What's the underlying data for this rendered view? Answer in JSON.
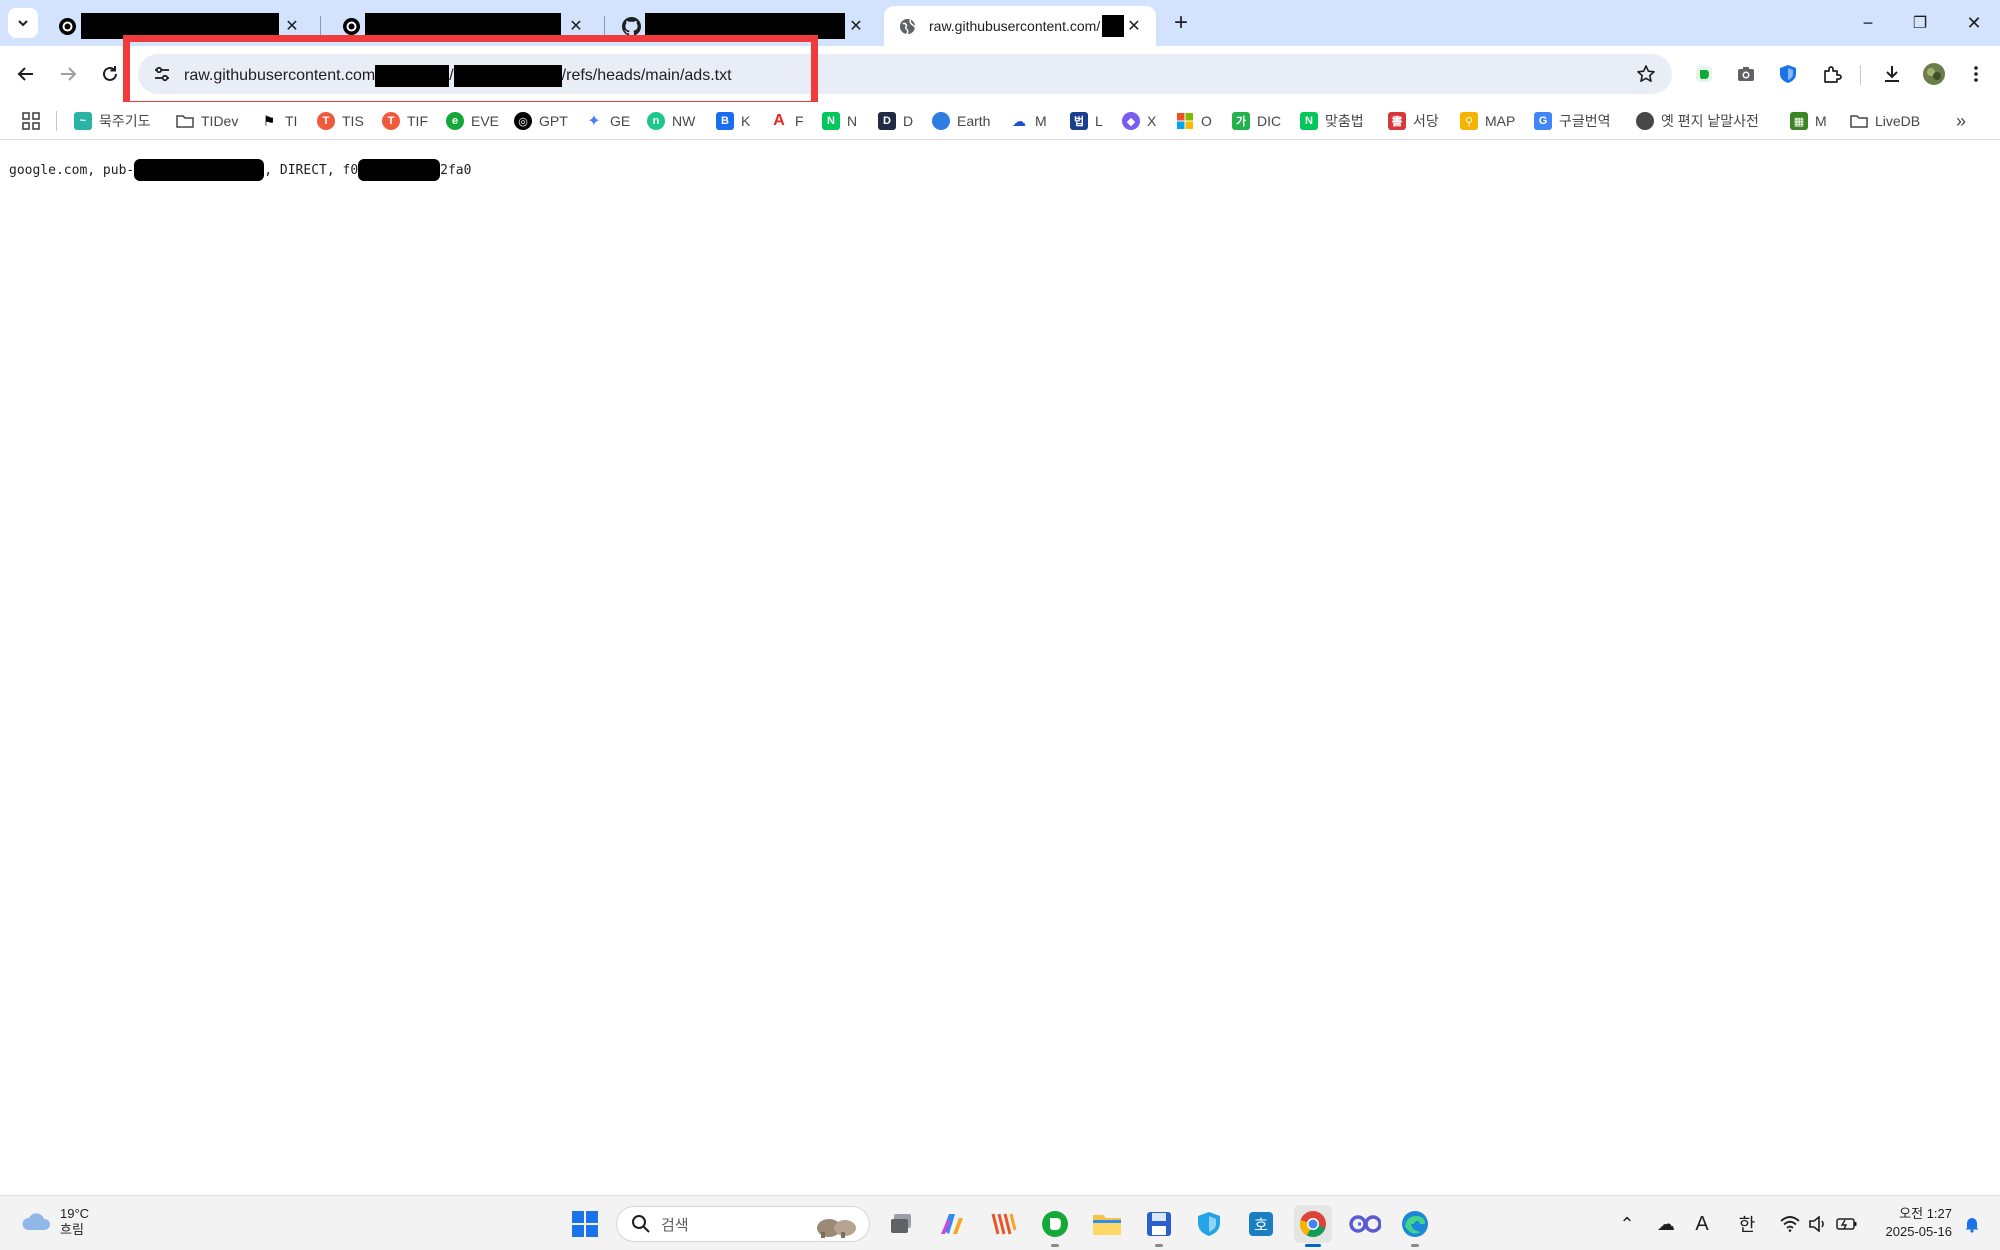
{
  "browser": {
    "tabs": [
      {
        "title_redacted": true,
        "favicon": "circle-logo-icon"
      },
      {
        "title_redacted": true,
        "favicon": "circle-logo-icon"
      },
      {
        "title_redacted": true,
        "favicon": "github-icon"
      },
      {
        "title": "raw.githubusercontent.com/",
        "favicon": "globe-icon",
        "active": true
      }
    ],
    "new_tab_label": "+",
    "window_controls": {
      "minimize": "−",
      "restore": "❐",
      "close": "✕"
    }
  },
  "toolbar": {
    "url_host": "raw.githubusercontent.com",
    "url_sep1": "/",
    "url_sep2": "/",
    "url_path": "/refs/heads/main/ads.txt",
    "highlight_color": "#ef3b3b"
  },
  "bookmarks": [
    {
      "label": "묵주기도",
      "icon": "chart-icon",
      "color": "#2bb3a6"
    },
    {
      "label": "TIDev",
      "icon": "folder-icon",
      "color": "#474747"
    },
    {
      "label": "TI",
      "icon": "flag-icon",
      "color": "#000000"
    },
    {
      "label": "TIS",
      "icon": "t-icon",
      "color": "#f05a3c"
    },
    {
      "label": "TIF",
      "icon": "t-icon",
      "color": "#f05a3c"
    },
    {
      "label": "EVE",
      "icon": "evernote-icon",
      "color": "#14a838"
    },
    {
      "label": "GPT",
      "icon": "openai-icon",
      "color": "#000000"
    },
    {
      "label": "GE",
      "icon": "gemini-icon",
      "color": "#4a7ef5"
    },
    {
      "label": "NW",
      "icon": "nw-icon",
      "color": "#1ec88c"
    },
    {
      "label": "K",
      "icon": "b-icon",
      "color": "#1a6cf0"
    },
    {
      "label": "F",
      "icon": "adobe-icon",
      "color": "#e8281e"
    },
    {
      "label": "N",
      "icon": "naver-icon",
      "color": "#03c75a"
    },
    {
      "label": "D",
      "icon": "d-icon",
      "color": "#1f2a44"
    },
    {
      "label": "Earth",
      "icon": "earth-icon",
      "color": "#2f7de1"
    },
    {
      "label": "M",
      "icon": "cloud-icon",
      "color": "#1f4fd1"
    },
    {
      "label": "L",
      "icon": "law-icon",
      "color": "#1a3f8f"
    },
    {
      "label": "X",
      "icon": "copilot-icon",
      "color": "#7b5cf0"
    },
    {
      "label": "O",
      "icon": "microsoft-icon",
      "color": "#f25022"
    },
    {
      "label": "DIC",
      "icon": "dic-icon",
      "color": "#22b14c"
    },
    {
      "label": "맞춤법",
      "icon": "naver-icon",
      "color": "#03c75a"
    },
    {
      "label": "서당",
      "icon": "seodang-icon",
      "color": "#d9363e"
    },
    {
      "label": "MAP",
      "icon": "map-pin-icon",
      "color": "#f4b400"
    },
    {
      "label": "구글번역",
      "icon": "translate-icon",
      "color": "#4285f4"
    },
    {
      "label": "옛 편지 낱말사전",
      "icon": "globe-icon",
      "color": "#474747"
    },
    {
      "label": "M",
      "icon": "minecraft-icon",
      "color": "#3c8527"
    },
    {
      "label": "LiveDB",
      "icon": "folder-icon",
      "color": "#474747"
    }
  ],
  "page": {
    "prefix": "google.com, pub-",
    "middle": ", DIRECT, f0",
    "suffix": "2fa0"
  },
  "taskbar": {
    "temperature": "19°C",
    "condition": "흐림",
    "search_placeholder": "검색",
    "time": "오전 1:27",
    "date": "2025-05-16",
    "ime_a": "A",
    "ime_lang": "한"
  }
}
